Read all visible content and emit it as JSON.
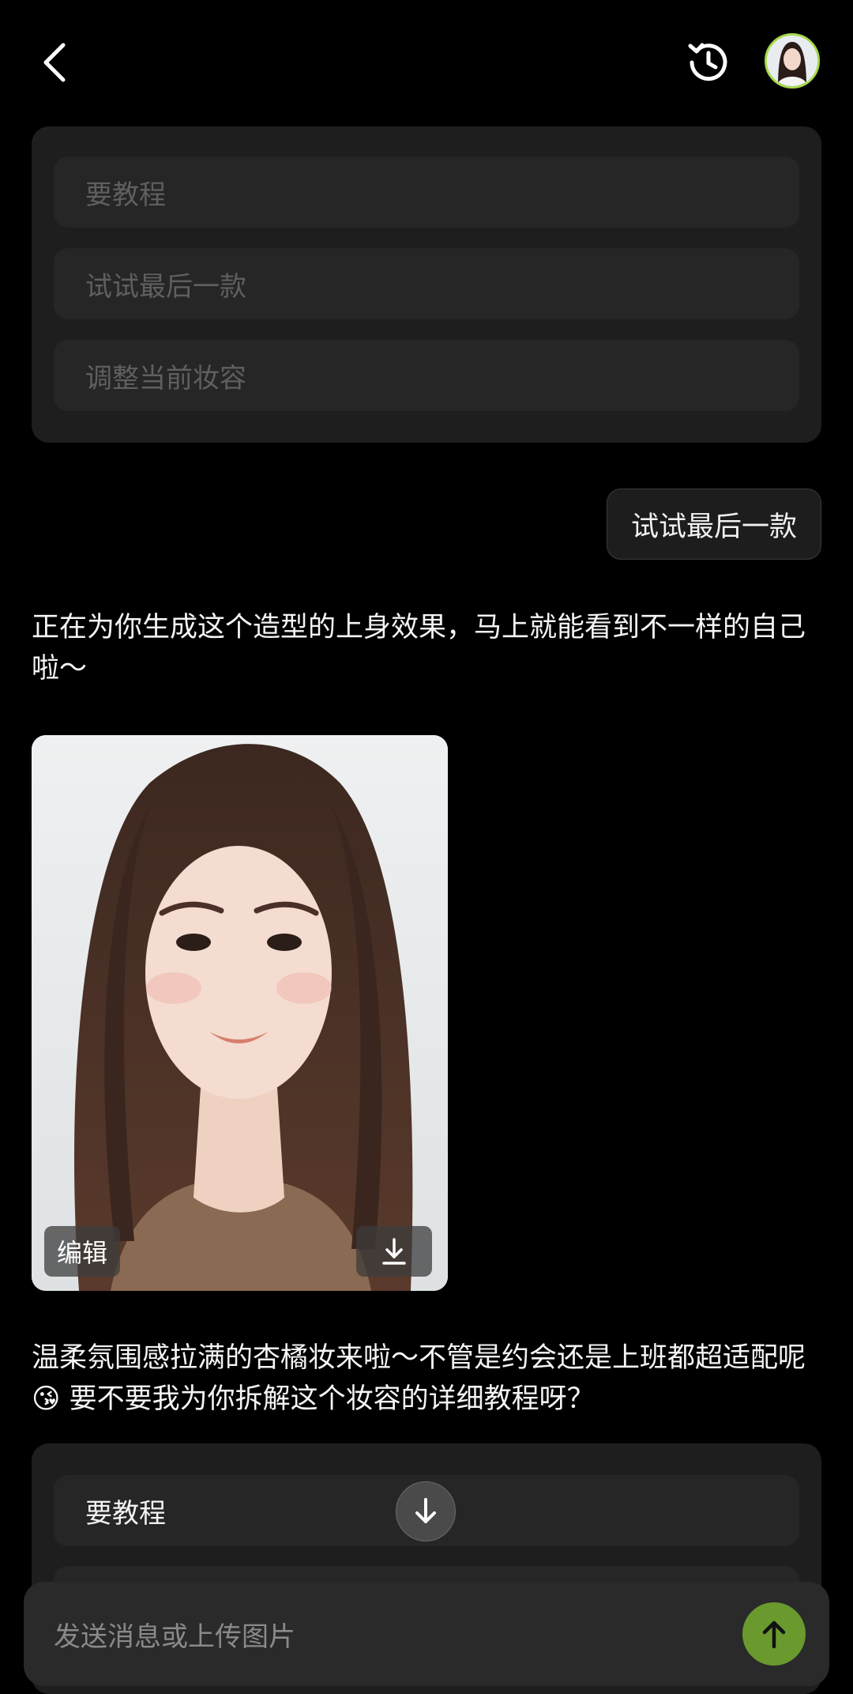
{
  "header": {
    "back_icon": "chevron-left-icon",
    "history_icon": "history-icon",
    "avatar_icon": "user-avatar"
  },
  "top_options": {
    "items": [
      {
        "label": "要教程"
      },
      {
        "label": "试试最后一款"
      },
      {
        "label": "调整当前妆容"
      }
    ]
  },
  "user_message": {
    "text": "试试最后一款"
  },
  "ai_message_1": {
    "text": "正在为你生成这个造型的上身效果，马上就能看到不一样的自己啦～"
  },
  "photo_card": {
    "edit_label": "编辑",
    "download_icon": "download-icon"
  },
  "ai_message_2": {
    "text_before_emoji": "温柔氛围感拉满的杏橘妆来啦～不管是约会还是上班都超适配呢",
    "emoji": "😘",
    "text_after_emoji": " 要不要我为你拆解这个妆容的详细教程呀？"
  },
  "bottom_options": {
    "items": [
      {
        "label": "要教程"
      }
    ]
  },
  "scroll_fab": {
    "icon": "arrow-down-icon"
  },
  "composer": {
    "placeholder": "发送消息或上传图片",
    "send_icon": "arrow-up-icon",
    "send_color": "#6a9a2e"
  }
}
